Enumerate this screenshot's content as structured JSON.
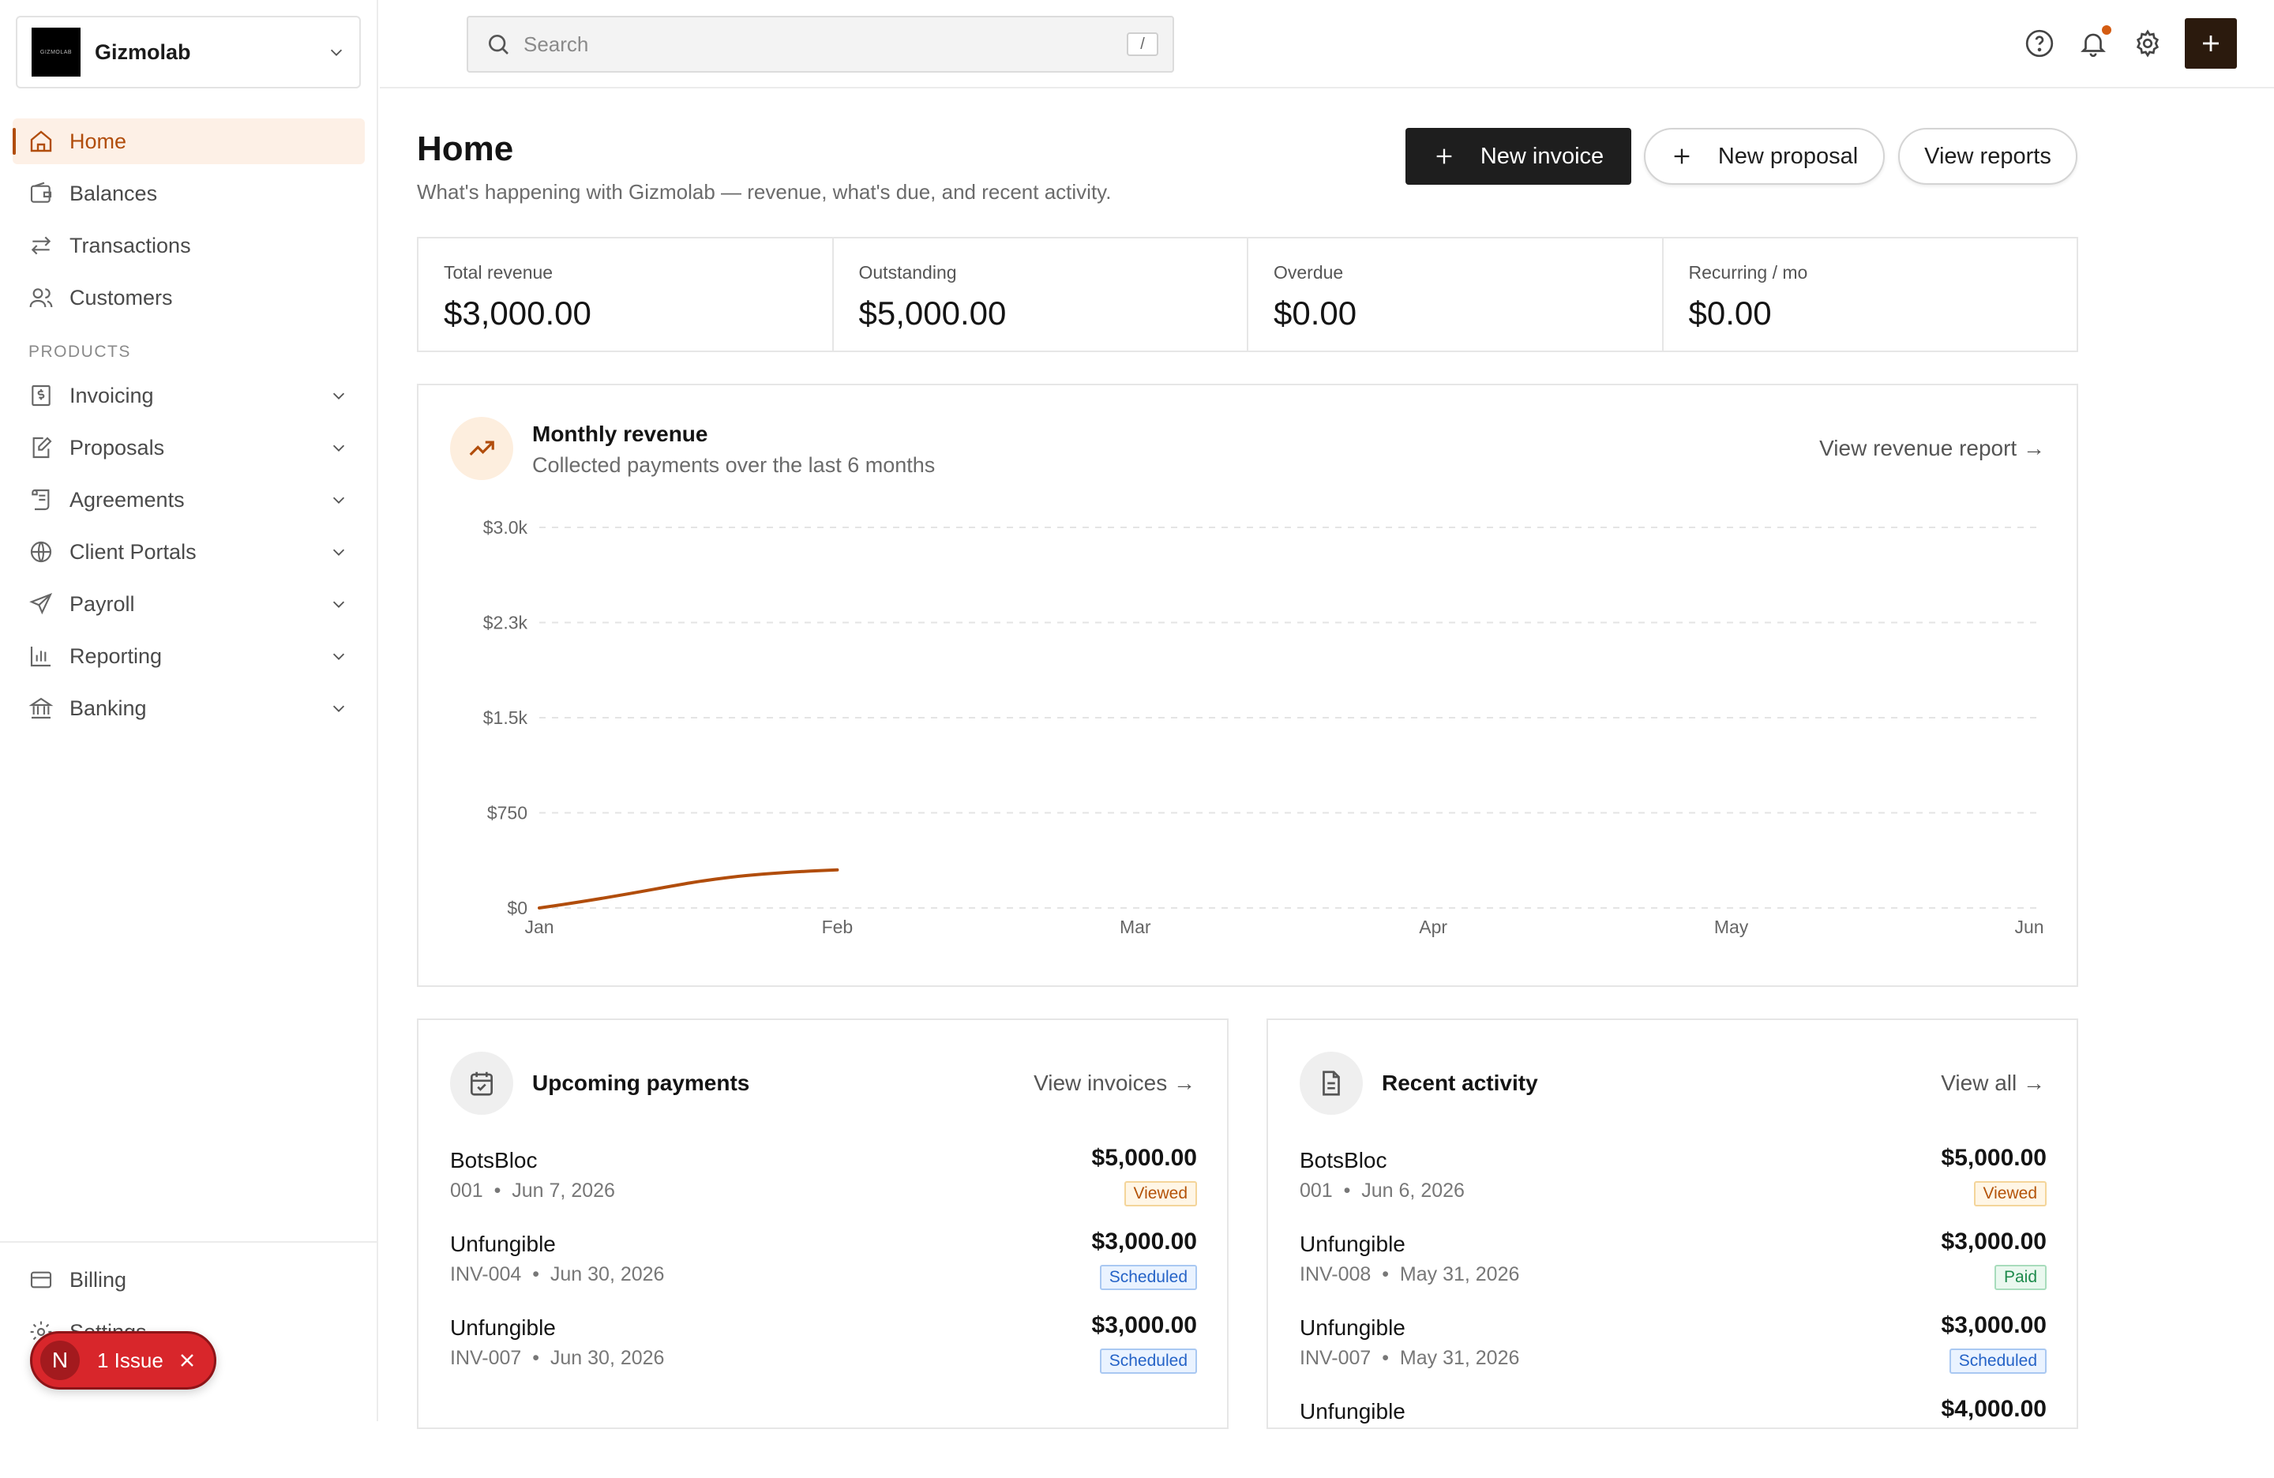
{
  "org": {
    "name": "Gizmolab",
    "logo_text": "GIZMOLAB"
  },
  "nav": {
    "home": "Home",
    "balances": "Balances",
    "transactions": "Transactions",
    "customers": "Customers",
    "section_products": "PRODUCTS",
    "invoicing": "Invoicing",
    "proposals": "Proposals",
    "agreements": "Agreements",
    "client_portals": "Client Portals",
    "payroll": "Payroll",
    "reporting": "Reporting",
    "banking": "Banking",
    "billing": "Billing",
    "settings": "Settings"
  },
  "issue": {
    "avatar": "N",
    "label": "1 Issue"
  },
  "search": {
    "placeholder": "Search",
    "shortcut": "/"
  },
  "page": {
    "title": "Home",
    "subtitle": "What's happening with Gizmolab — revenue, what's due, and recent activity."
  },
  "actions": {
    "new_invoice": "New invoice",
    "new_proposal": "New proposal",
    "view_reports": "View reports"
  },
  "stats": [
    {
      "label": "Total revenue",
      "value": "$3,000.00"
    },
    {
      "label": "Outstanding",
      "value": "$5,000.00"
    },
    {
      "label": "Overdue",
      "value": "$0.00"
    },
    {
      "label": "Recurring / mo",
      "value": "$0.00"
    }
  ],
  "chart_card": {
    "title": "Monthly revenue",
    "subtitle": "Collected payments over the last 6 months",
    "link": "View revenue report →"
  },
  "chart_data": {
    "type": "line",
    "title": "Monthly revenue",
    "categories": [
      "Jan",
      "Feb",
      "Mar",
      "Apr",
      "May",
      "Jun"
    ],
    "y_ticks": [
      "$0",
      "$750",
      "$1.5k",
      "$2.3k",
      "$3.0k"
    ],
    "ylim": [
      0,
      3000
    ],
    "series": [
      {
        "x": [
          "Jan",
          "Feb"
        ],
        "values": [
          0,
          300
        ]
      }
    ],
    "line_color": "#b14d0c",
    "grid": true
  },
  "upcoming": {
    "title": "Upcoming payments",
    "link": "View invoices →",
    "rows": [
      {
        "name": "BotsBloc",
        "id": "001",
        "date": "Jun 7, 2026",
        "amount": "$5,000.00",
        "status": "Viewed"
      },
      {
        "name": "Unfungible",
        "id": "INV-004",
        "date": "Jun 30, 2026",
        "amount": "$3,000.00",
        "status": "Scheduled"
      },
      {
        "name": "Unfungible",
        "id": "INV-007",
        "date": "Jun 30, 2026",
        "amount": "$3,000.00",
        "status": "Scheduled"
      }
    ]
  },
  "activity": {
    "title": "Recent activity",
    "link": "View all →",
    "rows": [
      {
        "name": "BotsBloc",
        "id": "001",
        "date": "Jun 6, 2026",
        "amount": "$5,000.00",
        "status": "Viewed"
      },
      {
        "name": "Unfungible",
        "id": "INV-008",
        "date": "May 31, 2026",
        "amount": "$3,000.00",
        "status": "Paid"
      },
      {
        "name": "Unfungible",
        "id": "INV-007",
        "date": "May 31, 2026",
        "amount": "$3,000.00",
        "status": "Scheduled"
      },
      {
        "name": "Unfungible",
        "amount": "$4,000.00"
      }
    ]
  },
  "colors": {
    "accent": "#b14d0c",
    "dark_button": "#1e1e1e",
    "plus_button": "#2b1a0d",
    "issue": "#d8262b"
  }
}
